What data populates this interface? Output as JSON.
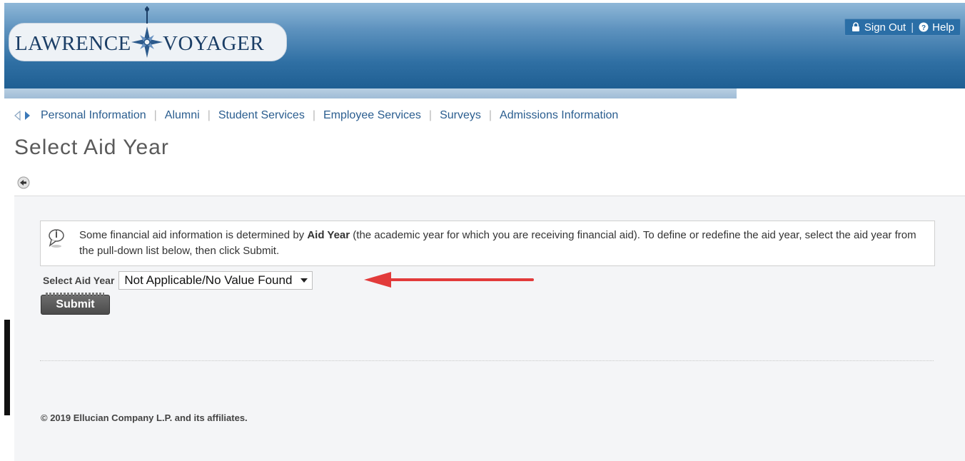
{
  "header": {
    "logo_left": "LAWRENCE",
    "logo_right": "VOYAGER",
    "sign_out": "Sign Out",
    "help": "Help"
  },
  "nav": {
    "items": [
      "Personal Information",
      "Alumni",
      "Student Services",
      "Employee Services",
      "Surveys",
      "Admissions Information"
    ]
  },
  "page": {
    "title": "Select Aid Year"
  },
  "info": {
    "part1": "Some financial aid information is determined by ",
    "bold": "Aid Year",
    "part2": " (the academic year for which you are receiving financial aid). To define or redefine the aid year, select the aid year from the pull-down list below, then click Submit."
  },
  "form": {
    "label": "Select Aid Year",
    "selected": "Not Applicable/No Value Found",
    "submit": "Submit"
  },
  "footer": {
    "text": "© 2019 Ellucian Company L.P. and its affiliates."
  },
  "colors": {
    "header_blue": "#2f6fa3",
    "nav_link": "#2a5d8f",
    "annotation_arrow": "#e23b3b"
  }
}
